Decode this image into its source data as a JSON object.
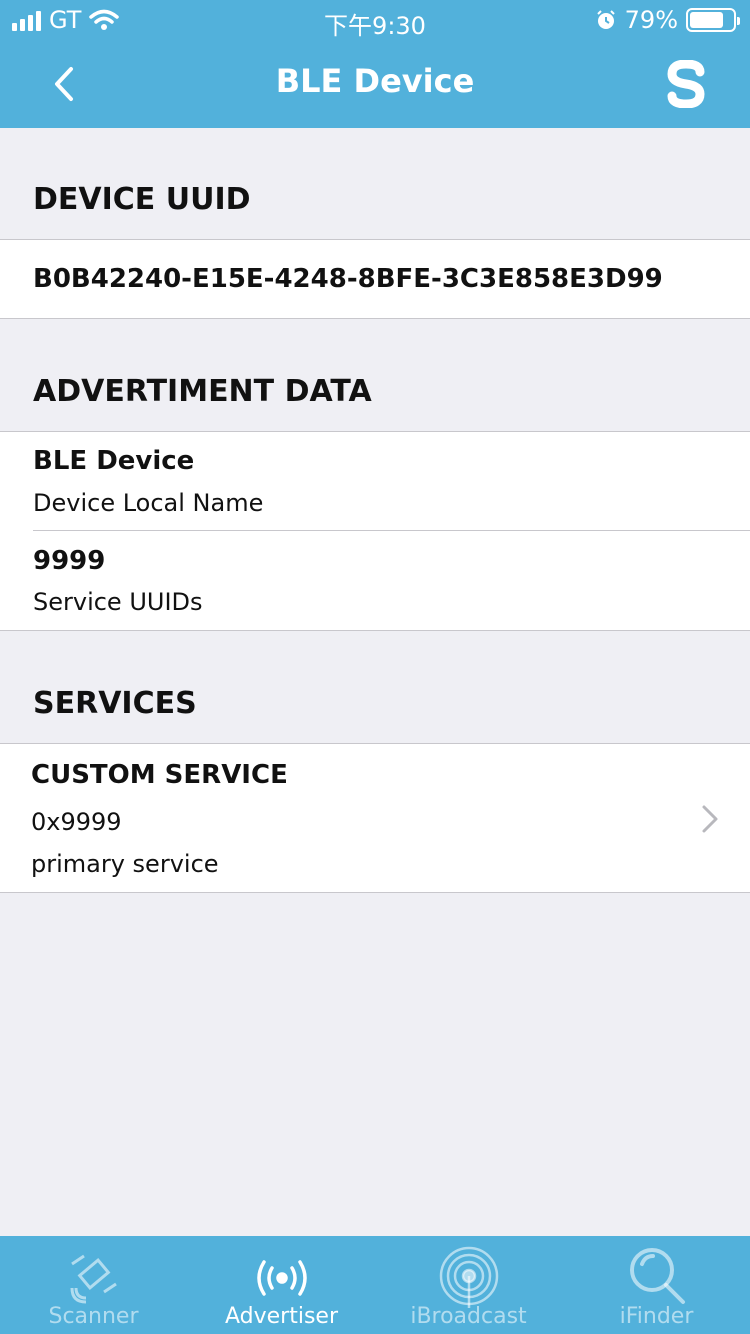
{
  "status_bar": {
    "carrier": "GT",
    "time": "下午9:30",
    "battery": "79%",
    "battery_level": 0.79
  },
  "nav": {
    "title": "BLE Device"
  },
  "sections": {
    "uuid_header": "DEVICE UUID",
    "uuid_value": "B0B42240-E15E-4248-8BFE-3C3E858E3D99",
    "adv_header": "ADVERTIMENT DATA",
    "adv_items": [
      {
        "value": "BLE Device",
        "label": "Device Local Name"
      },
      {
        "value": "9999",
        "label": "Service UUIDs"
      }
    ],
    "services_header": "SERVICES",
    "service": {
      "name": "CUSTOM SERVICE",
      "uuid": "0x9999",
      "type": "primary service"
    }
  },
  "tabs": [
    {
      "label": "Scanner",
      "icon": "satellite-icon",
      "active": false
    },
    {
      "label": "Advertiser",
      "icon": "broadcast-icon",
      "active": true
    },
    {
      "label": "iBroadcast",
      "icon": "ibeacon-icon",
      "active": false
    },
    {
      "label": "iFinder",
      "icon": "magnifier-icon",
      "active": false
    }
  ],
  "colors": {
    "accent": "#52b1db",
    "background": "#efeff4",
    "separator": "#c8c7cc"
  }
}
